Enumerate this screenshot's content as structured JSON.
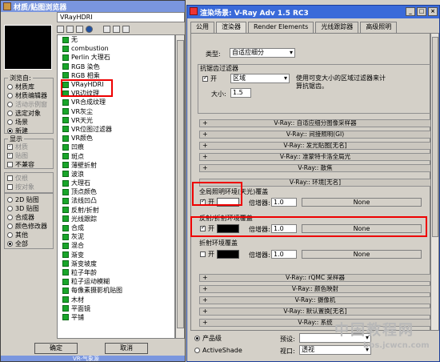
{
  "browser": {
    "title": "材质/贴图浏览器",
    "name_value": "VRayHDRI",
    "browse_from": {
      "label": "浏览自:",
      "options": [
        "材质库",
        "材质编辑器",
        "活动示例窗",
        "选定对象",
        "场景",
        "新建"
      ],
      "selected": "新建"
    },
    "show": {
      "label": "显示",
      "options": [
        "材质",
        "贴图",
        "不兼容"
      ]
    },
    "filters": [
      "仅根",
      "按对象"
    ],
    "map_types": {
      "options": [
        "2D 贴图",
        "3D 贴图",
        "合成器",
        "颜色修改器",
        "其他",
        "全部"
      ],
      "selected": "全部"
    },
    "items": [
      "无",
      "combustion",
      "Perlin 大理石",
      "RGB 染色",
      "RGB 相乘",
      "VRayHDRI",
      "VR边纹理",
      "VR合成纹理",
      "VR灰尘",
      "VR天光",
      "VR位图过滤器",
      "VR颜色",
      "凹痕",
      "斑点",
      "薄壁折射",
      "波浪",
      "大理石",
      "顶点颜色",
      "法线凹凸",
      "反射/折射",
      "光线跟踪",
      "合成",
      "灰泥",
      "混合",
      "渐变",
      "渐变坡度",
      "粒子年龄",
      "粒子运动模糊",
      "每像素摄影机贴图",
      "木材",
      "平面镜",
      "平铺"
    ],
    "ok": "确定",
    "cancel": "取消",
    "footer": "VR-气象源"
  },
  "render": {
    "title": "渲染场景: V-Ray Adv 1.5 RC3",
    "tabs": [
      "公用",
      "渲染器",
      "Render Elements",
      "光线跟踪器",
      "高级照明"
    ],
    "active_tab": "渲染器",
    "type_label": "类型:",
    "type_value": "自适应细分",
    "aa_filter_title": "抗锯齿过滤器",
    "aa_on": "开",
    "aa_filter_value": "区域",
    "aa_desc": "使用可变大小的区域过滤器来计算抗锯齿。",
    "size_label": "大小:",
    "size_value": "1.5",
    "rollouts_a": [
      "V-Ray:: 自适应细分图像采样器",
      "V-Ray:: 间接照明(GI)",
      "V-Ray:: 发光贴图[无名]",
      "V-Ray:: 准蒙特卡洛全局光",
      "V-Ray:: 散焦"
    ],
    "env_rollout": "V-Ray:: 环境[无名]",
    "gi_env_title": "全局照明环境(天光)覆盖",
    "refl_env_title": "反射/折射环境覆盖",
    "refr_env_title": "折射环境覆盖",
    "on_label": "开",
    "mult_label": "倍增器:",
    "mult_value": "1.0",
    "none_label": "None",
    "rollouts_b": [
      "V-Ray:: rQMC 采样器",
      "V-Ray:: 颜色映射",
      "V-Ray:: 摄像机",
      "V-Ray:: 默认置换[无名]",
      "V-Ray:: 系统"
    ],
    "product_label": "产品级",
    "activeshade_label": "ActiveShade",
    "preset_label": "预设:",
    "viewport_label": "视口:",
    "viewport_value": "透视",
    "colors": {
      "gi_swatch": "#ffffff",
      "refl_swatch": "#000000",
      "refr_swatch": "#000000",
      "highlight": "#e00000"
    }
  },
  "watermark": {
    "cn": "中国教程网",
    "url": "bbs.jcwcn.com"
  }
}
